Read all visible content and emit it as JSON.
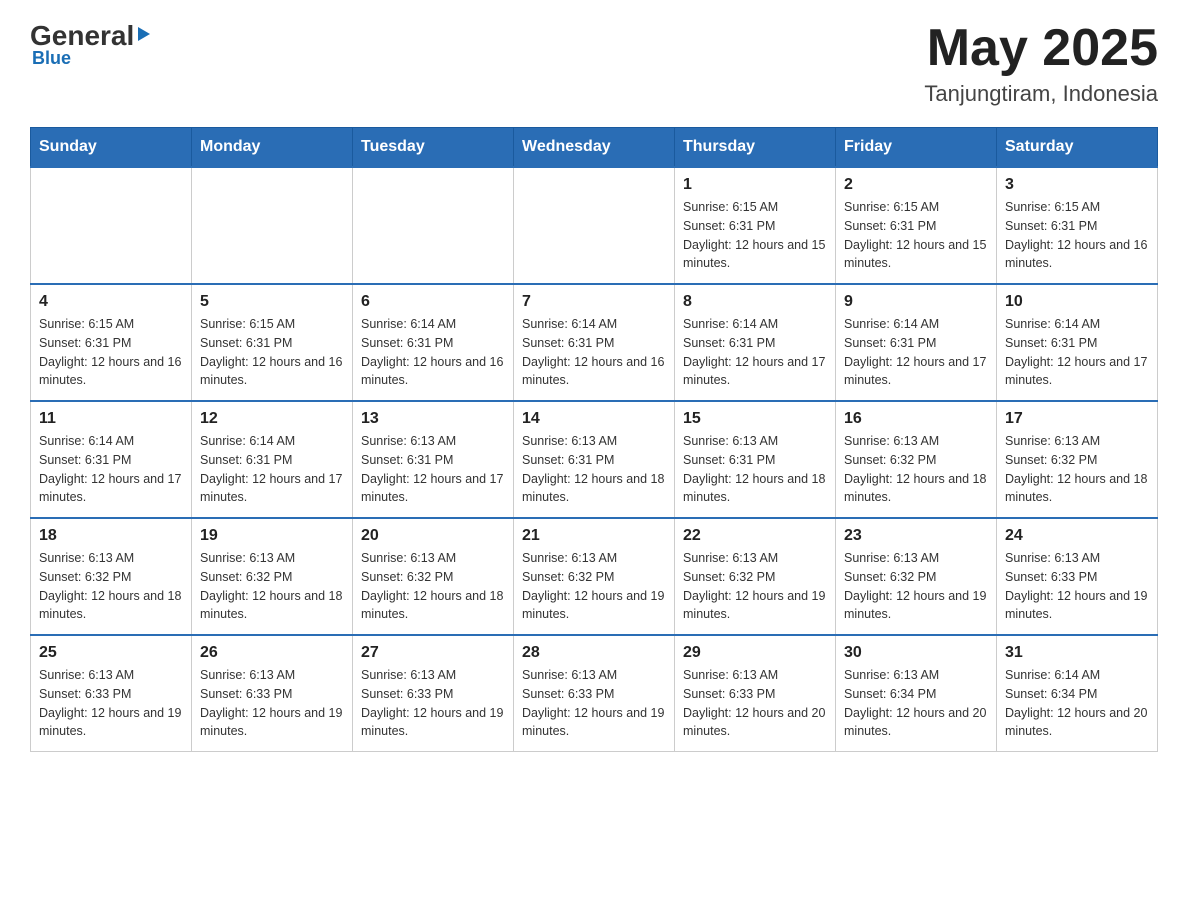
{
  "header": {
    "logo_general": "General",
    "logo_arrow": "▶",
    "logo_blue": "Blue",
    "month_year": "May 2025",
    "location": "Tanjungtiram, Indonesia"
  },
  "days_of_week": [
    "Sunday",
    "Monday",
    "Tuesday",
    "Wednesday",
    "Thursday",
    "Friday",
    "Saturday"
  ],
  "weeks": [
    [
      {
        "day": "",
        "info": ""
      },
      {
        "day": "",
        "info": ""
      },
      {
        "day": "",
        "info": ""
      },
      {
        "day": "",
        "info": ""
      },
      {
        "day": "1",
        "info": "Sunrise: 6:15 AM\nSunset: 6:31 PM\nDaylight: 12 hours and 15 minutes."
      },
      {
        "day": "2",
        "info": "Sunrise: 6:15 AM\nSunset: 6:31 PM\nDaylight: 12 hours and 15 minutes."
      },
      {
        "day": "3",
        "info": "Sunrise: 6:15 AM\nSunset: 6:31 PM\nDaylight: 12 hours and 16 minutes."
      }
    ],
    [
      {
        "day": "4",
        "info": "Sunrise: 6:15 AM\nSunset: 6:31 PM\nDaylight: 12 hours and 16 minutes."
      },
      {
        "day": "5",
        "info": "Sunrise: 6:15 AM\nSunset: 6:31 PM\nDaylight: 12 hours and 16 minutes."
      },
      {
        "day": "6",
        "info": "Sunrise: 6:14 AM\nSunset: 6:31 PM\nDaylight: 12 hours and 16 minutes."
      },
      {
        "day": "7",
        "info": "Sunrise: 6:14 AM\nSunset: 6:31 PM\nDaylight: 12 hours and 16 minutes."
      },
      {
        "day": "8",
        "info": "Sunrise: 6:14 AM\nSunset: 6:31 PM\nDaylight: 12 hours and 17 minutes."
      },
      {
        "day": "9",
        "info": "Sunrise: 6:14 AM\nSunset: 6:31 PM\nDaylight: 12 hours and 17 minutes."
      },
      {
        "day": "10",
        "info": "Sunrise: 6:14 AM\nSunset: 6:31 PM\nDaylight: 12 hours and 17 minutes."
      }
    ],
    [
      {
        "day": "11",
        "info": "Sunrise: 6:14 AM\nSunset: 6:31 PM\nDaylight: 12 hours and 17 minutes."
      },
      {
        "day": "12",
        "info": "Sunrise: 6:14 AM\nSunset: 6:31 PM\nDaylight: 12 hours and 17 minutes."
      },
      {
        "day": "13",
        "info": "Sunrise: 6:13 AM\nSunset: 6:31 PM\nDaylight: 12 hours and 17 minutes."
      },
      {
        "day": "14",
        "info": "Sunrise: 6:13 AM\nSunset: 6:31 PM\nDaylight: 12 hours and 18 minutes."
      },
      {
        "day": "15",
        "info": "Sunrise: 6:13 AM\nSunset: 6:31 PM\nDaylight: 12 hours and 18 minutes."
      },
      {
        "day": "16",
        "info": "Sunrise: 6:13 AM\nSunset: 6:32 PM\nDaylight: 12 hours and 18 minutes."
      },
      {
        "day": "17",
        "info": "Sunrise: 6:13 AM\nSunset: 6:32 PM\nDaylight: 12 hours and 18 minutes."
      }
    ],
    [
      {
        "day": "18",
        "info": "Sunrise: 6:13 AM\nSunset: 6:32 PM\nDaylight: 12 hours and 18 minutes."
      },
      {
        "day": "19",
        "info": "Sunrise: 6:13 AM\nSunset: 6:32 PM\nDaylight: 12 hours and 18 minutes."
      },
      {
        "day": "20",
        "info": "Sunrise: 6:13 AM\nSunset: 6:32 PM\nDaylight: 12 hours and 18 minutes."
      },
      {
        "day": "21",
        "info": "Sunrise: 6:13 AM\nSunset: 6:32 PM\nDaylight: 12 hours and 19 minutes."
      },
      {
        "day": "22",
        "info": "Sunrise: 6:13 AM\nSunset: 6:32 PM\nDaylight: 12 hours and 19 minutes."
      },
      {
        "day": "23",
        "info": "Sunrise: 6:13 AM\nSunset: 6:32 PM\nDaylight: 12 hours and 19 minutes."
      },
      {
        "day": "24",
        "info": "Sunrise: 6:13 AM\nSunset: 6:33 PM\nDaylight: 12 hours and 19 minutes."
      }
    ],
    [
      {
        "day": "25",
        "info": "Sunrise: 6:13 AM\nSunset: 6:33 PM\nDaylight: 12 hours and 19 minutes."
      },
      {
        "day": "26",
        "info": "Sunrise: 6:13 AM\nSunset: 6:33 PM\nDaylight: 12 hours and 19 minutes."
      },
      {
        "day": "27",
        "info": "Sunrise: 6:13 AM\nSunset: 6:33 PM\nDaylight: 12 hours and 19 minutes."
      },
      {
        "day": "28",
        "info": "Sunrise: 6:13 AM\nSunset: 6:33 PM\nDaylight: 12 hours and 19 minutes."
      },
      {
        "day": "29",
        "info": "Sunrise: 6:13 AM\nSunset: 6:33 PM\nDaylight: 12 hours and 20 minutes."
      },
      {
        "day": "30",
        "info": "Sunrise: 6:13 AM\nSunset: 6:34 PM\nDaylight: 12 hours and 20 minutes."
      },
      {
        "day": "31",
        "info": "Sunrise: 6:14 AM\nSunset: 6:34 PM\nDaylight: 12 hours and 20 minutes."
      }
    ]
  ]
}
